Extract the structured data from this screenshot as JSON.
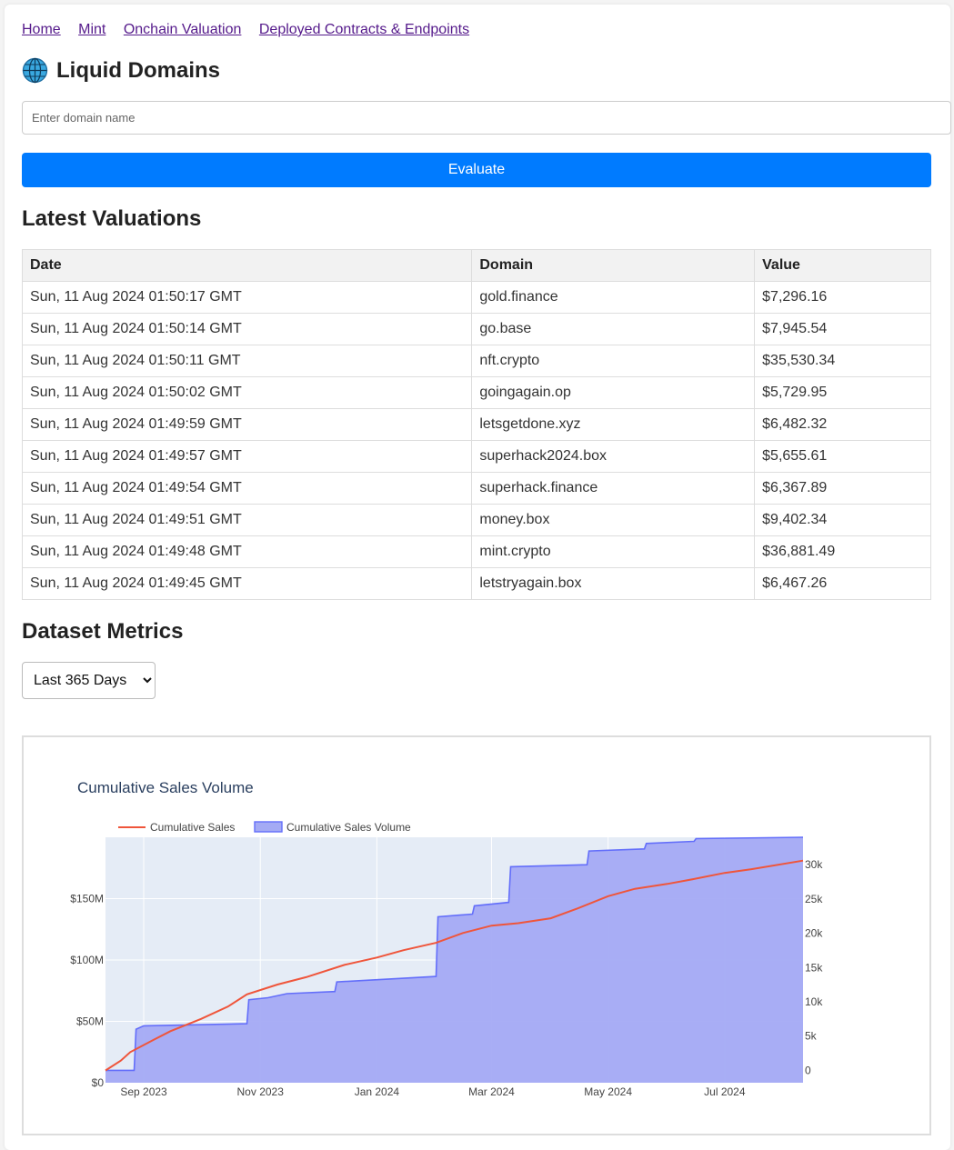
{
  "nav": {
    "links": [
      "Home",
      "Mint",
      "Onchain Valuation",
      "Deployed Contracts & Endpoints"
    ]
  },
  "brand": {
    "title": "Liquid Domains",
    "icon": "globe-icon"
  },
  "search": {
    "placeholder": "Enter domain name",
    "value": ""
  },
  "evaluate_label": "Evaluate",
  "valuations": {
    "heading": "Latest Valuations",
    "columns": [
      "Date",
      "Domain",
      "Value"
    ],
    "rows": [
      [
        "Sun, 11 Aug 2024 01:50:17 GMT",
        "gold.finance",
        "$7,296.16"
      ],
      [
        "Sun, 11 Aug 2024 01:50:14 GMT",
        "go.base",
        "$7,945.54"
      ],
      [
        "Sun, 11 Aug 2024 01:50:11 GMT",
        "nft.crypto",
        "$35,530.34"
      ],
      [
        "Sun, 11 Aug 2024 01:50:02 GMT",
        "goingagain.op",
        "$5,729.95"
      ],
      [
        "Sun, 11 Aug 2024 01:49:59 GMT",
        "letsgetdone.xyz",
        "$6,482.32"
      ],
      [
        "Sun, 11 Aug 2024 01:49:57 GMT",
        "superhack2024.box",
        "$5,655.61"
      ],
      [
        "Sun, 11 Aug 2024 01:49:54 GMT",
        "superhack.finance",
        "$6,367.89"
      ],
      [
        "Sun, 11 Aug 2024 01:49:51 GMT",
        "money.box",
        "$9,402.34"
      ],
      [
        "Sun, 11 Aug 2024 01:49:48 GMT",
        "mint.crypto",
        "$36,881.49"
      ],
      [
        "Sun, 11 Aug 2024 01:49:45 GMT",
        "letstryagain.box",
        "$6,467.26"
      ]
    ]
  },
  "metrics": {
    "heading": "Dataset Metrics",
    "range_selected": "Last 365 Days"
  },
  "colors": {
    "sales_line": "#ef553b",
    "volume_fill": "#a4aaf4",
    "volume_line": "#636efa",
    "plot_bg": "#e5ecf6",
    "button": "#007bff"
  },
  "chart_data": {
    "type": "area",
    "title": "Cumulative Sales Volume",
    "legend": [
      "Cumulative Sales",
      "Cumulative Sales Volume"
    ],
    "legend_position": "top-left",
    "grid": true,
    "x_ticks": [
      "Sep 2023",
      "Nov 2023",
      "Jan 2024",
      "Mar 2024",
      "May 2024",
      "Jul 2024"
    ],
    "x_range": [
      "2023-08-12",
      "2024-08-11"
    ],
    "y_left_ticks": [
      "$0",
      "$50M",
      "$100M",
      "$150M"
    ],
    "y_left_range": [
      0,
      200
    ],
    "y_right_ticks": [
      "0",
      "5k",
      "10k",
      "15k",
      "20k",
      "25k",
      "30k"
    ],
    "y_right_range": [
      -1800,
      34000
    ],
    "series": [
      {
        "name": "Cumulative Sales",
        "axis": "left",
        "unit": "$M",
        "x": [
          "2023-08-12",
          "2023-08-20",
          "2023-08-25",
          "2023-09-05",
          "2023-09-15",
          "2023-10-01",
          "2023-10-15",
          "2023-10-25",
          "2023-11-10",
          "2023-11-25",
          "2023-12-15",
          "2024-01-01",
          "2024-01-15",
          "2024-02-01",
          "2024-02-15",
          "2024-03-01",
          "2024-03-15",
          "2024-04-01",
          "2024-04-15",
          "2024-05-01",
          "2024-05-15",
          "2024-06-01",
          "2024-06-15",
          "2024-07-01",
          "2024-07-15",
          "2024-08-11"
        ],
        "values": [
          10,
          18,
          25,
          34,
          42,
          52,
          62,
          72,
          80,
          86,
          96,
          102,
          108,
          114,
          122,
          128,
          130,
          134,
          142,
          152,
          158,
          162,
          166,
          171,
          174,
          181
        ]
      },
      {
        "name": "Cumulative Sales Volume",
        "axis": "right",
        "unit": "count",
        "x": [
          "2023-08-12",
          "2023-08-27",
          "2023-08-28",
          "2023-09-01",
          "2023-10-25",
          "2023-10-26",
          "2023-11-05",
          "2023-11-15",
          "2023-12-10",
          "2023-12-11",
          "2024-02-01",
          "2024-02-02",
          "2024-02-20",
          "2024-02-21",
          "2024-03-10",
          "2024-03-11",
          "2024-04-20",
          "2024-04-21",
          "2024-05-20",
          "2024-05-21",
          "2024-06-15",
          "2024-06-16",
          "2024-08-11"
        ],
        "values": [
          0,
          0,
          6000,
          6500,
          6800,
          10300,
          10600,
          11200,
          11500,
          12900,
          13700,
          22400,
          22800,
          24000,
          24500,
          29700,
          30000,
          32000,
          32300,
          33100,
          33400,
          33800,
          34000
        ]
      }
    ]
  }
}
